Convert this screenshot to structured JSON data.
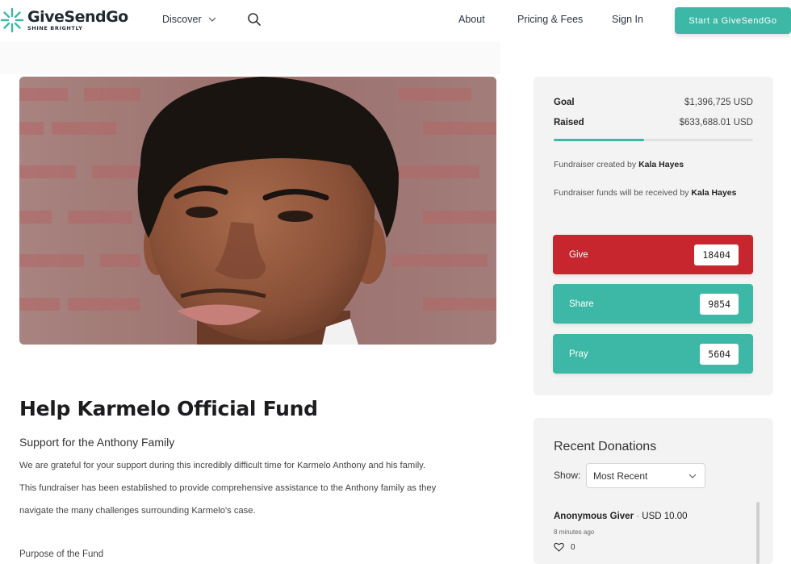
{
  "header": {
    "logo_name": "GiveSendGo",
    "logo_tagline": "SHINE BRIGHTLY",
    "discover_label": "Discover",
    "nav_links": [
      "About",
      "Pricing & Fees",
      "Sign In"
    ],
    "cta_label": "Start a GiveSendGo"
  },
  "campaign": {
    "title": "Help Karmelo Official Fund",
    "subtitle": "Support for the Anthony Family",
    "paragraph_lines": [
      "We are grateful for your support during this incredibly difficult time for Karmelo Anthony and his family.",
      "This fundraiser has been established to provide comprehensive assistance to the Anthony family as they",
      "navigate the many challenges surrounding Karmelo's case."
    ],
    "section_heading": "Purpose of the Fund"
  },
  "sidebar": {
    "goal_label": "Goal",
    "goal_value": "$1,396,725 USD",
    "raised_label": "Raised",
    "raised_value": "$633,688.01 USD",
    "progress_fraction": 0.454,
    "created_by_prefix": "Fundraiser created by",
    "created_by_name": "Kala Hayes",
    "received_by_prefix": "Fundraiser funds will be received by",
    "received_by_name": "Kala Hayes",
    "actions": [
      {
        "label": "Give",
        "count": "18404",
        "color": "#c8262f"
      },
      {
        "label": "Share",
        "count": "9854",
        "color": "#3db8a6"
      },
      {
        "label": "Pray",
        "count": "5604",
        "color": "#3db8a6"
      }
    ]
  },
  "recent": {
    "title": "Recent Donations",
    "show_label": "Show:",
    "show_selected": "Most Recent",
    "donation": {
      "name": "Anonymous Giver",
      "amount": "USD 10.00",
      "time": "8 minutes ago",
      "likes": "0"
    }
  },
  "colors": {
    "brand_teal": "#3db8a6",
    "give_red": "#c8262f"
  }
}
